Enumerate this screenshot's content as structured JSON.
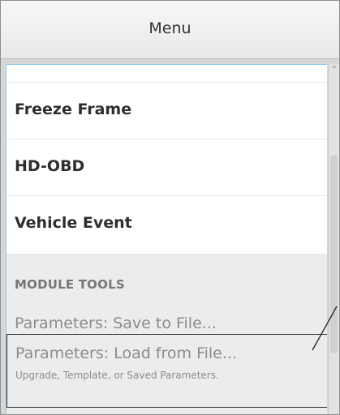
{
  "header": {
    "title": "Menu"
  },
  "menu": {
    "items": [
      {
        "label": ""
      },
      {
        "label": "Freeze Frame"
      },
      {
        "label": "HD-OBD"
      },
      {
        "label": "Vehicle Event"
      }
    ],
    "section_title": "MODULE TOOLS",
    "module_items": [
      {
        "label": "Parameters: Save to File..."
      },
      {
        "label": "Parameters: Load from File...",
        "subtitle": "Upgrade, Template, or Saved Parameters."
      }
    ]
  },
  "icons": {
    "scroll_up": "chevron-up-icon"
  },
  "colors": {
    "accent": "#8ec7e8",
    "header_text": "#333333",
    "disabled_text": "#8c8c8c",
    "selection_border": "#303030"
  }
}
